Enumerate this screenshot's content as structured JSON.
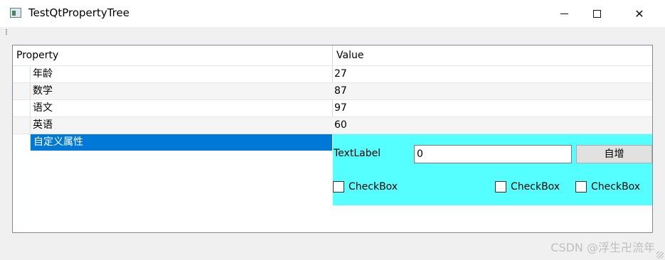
{
  "window": {
    "title": "TestQtPropertyTree"
  },
  "tree": {
    "header": {
      "property": "Property",
      "value": "Value"
    },
    "rows": [
      {
        "name": "年龄",
        "value": "27"
      },
      {
        "name": "数学",
        "value": "87"
      },
      {
        "name": "语文",
        "value": "97"
      },
      {
        "name": "英语",
        "value": "60"
      },
      {
        "name": "自定义属性",
        "value": ""
      }
    ],
    "editor": {
      "label": "TextLabel",
      "input_value": "0",
      "button_label": "自增",
      "checkboxes": [
        "CheckBox",
        "CheckBox",
        "CheckBox"
      ]
    }
  },
  "watermark": "CSDN @浮生卍流年",
  "colors": {
    "selection": "#0078d7",
    "editor_background": "#55ffff"
  }
}
